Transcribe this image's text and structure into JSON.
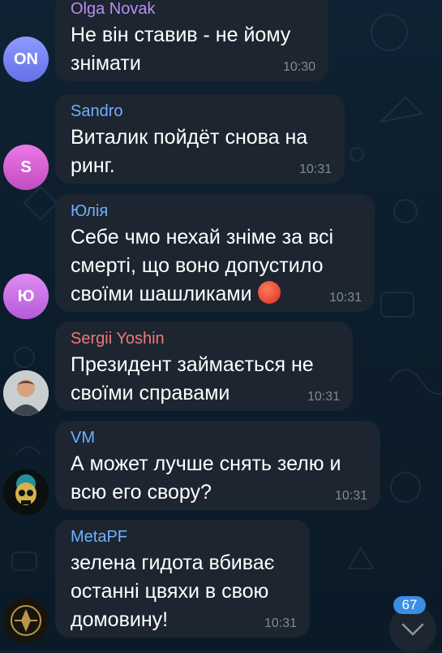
{
  "messages": [
    {
      "sender": "Olga Novak",
      "sender_color": "#b78ef2",
      "avatar_initials": "ON",
      "avatar_color": "#7a86f2",
      "lines": [
        "Не він ставив - не йому",
        "знімати"
      ],
      "time": "10:30"
    },
    {
      "sender": "Sandro",
      "sender_color": "#6fb1ff",
      "avatar_initials": "S",
      "avatar_color": "#d55fd0",
      "lines": [
        "Виталик пойдёт снова на",
        "ринг."
      ],
      "time": "10:31"
    },
    {
      "sender": "Юлія",
      "sender_color": "#6fb1ff",
      "avatar_initials": "Ю",
      "avatar_color": "#c768e8",
      "lines": [
        "Себе чмо нехай зніме за всі",
        "смерті, що воно допустило",
        "своїми шашликами"
      ],
      "emoji": "angry-face-emoji",
      "time": "10:31"
    },
    {
      "sender": "Sergii Yoshin",
      "sender_color": "#f07a74",
      "avatar_image": "man-portrait-avatar",
      "lines": [
        "Президент займається не",
        "своїми справами"
      ],
      "time": "10:31"
    },
    {
      "sender": "VM",
      "sender_color": "#6fb1ff",
      "avatar_image": "skull-avatar",
      "lines": [
        "А может лучше снять зелю и",
        "всю его свору?"
      ],
      "time": "10:31"
    },
    {
      "sender": "MetaPF",
      "sender_color": "#6fb1ff",
      "avatar_image": "emblem-avatar",
      "lines": [
        "зелена гидота вбиває",
        "останні цвяхи в свою",
        "домовину!"
      ],
      "time": "10:31"
    }
  ],
  "unread_count": "67",
  "scroll_down_icon": "chevron-down-icon",
  "colors": {
    "bubble": "#1c2530",
    "badge": "#3a8ee6",
    "time": "#7f8b98"
  }
}
